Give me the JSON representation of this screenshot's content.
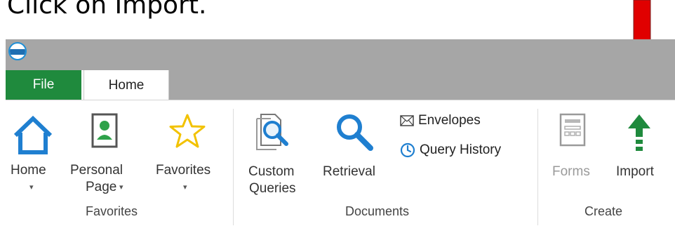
{
  "instruction": "Click on Import.",
  "tabs": {
    "file": "File",
    "home": "Home"
  },
  "favorites_group": {
    "label": "Favorites",
    "home": {
      "label": "Home",
      "caret": "▾"
    },
    "personal_page": {
      "label_line1": "Personal",
      "label_line2": "Page",
      "caret": "▾"
    },
    "favorites": {
      "label": "Favorites",
      "caret": "▾"
    }
  },
  "documents_group": {
    "label": "Documents",
    "custom_queries": {
      "label_line1": "Custom",
      "label_line2": "Queries"
    },
    "retrieval": {
      "label": "Retrieval"
    },
    "envelopes": {
      "label": "Envelopes"
    },
    "query_history": {
      "label": "Query History"
    }
  },
  "create_group": {
    "label": "Create",
    "forms": {
      "label": "Forms",
      "disabled": true
    },
    "import": {
      "label": "Import"
    }
  },
  "colors": {
    "file_tab": "#1f8a3d",
    "titlebar": "#a6a6a6",
    "accent_blue": "#1f7fd0",
    "import_green": "#1f8a3d",
    "annotation_arrow": "#e00000"
  },
  "icons": [
    "app-logo-icon",
    "house-icon",
    "personal-page-icon",
    "star-icon",
    "custom-queries-icon",
    "magnifier-icon",
    "envelope-icon",
    "clock-icon",
    "forms-icon",
    "import-arrow-icon"
  ]
}
